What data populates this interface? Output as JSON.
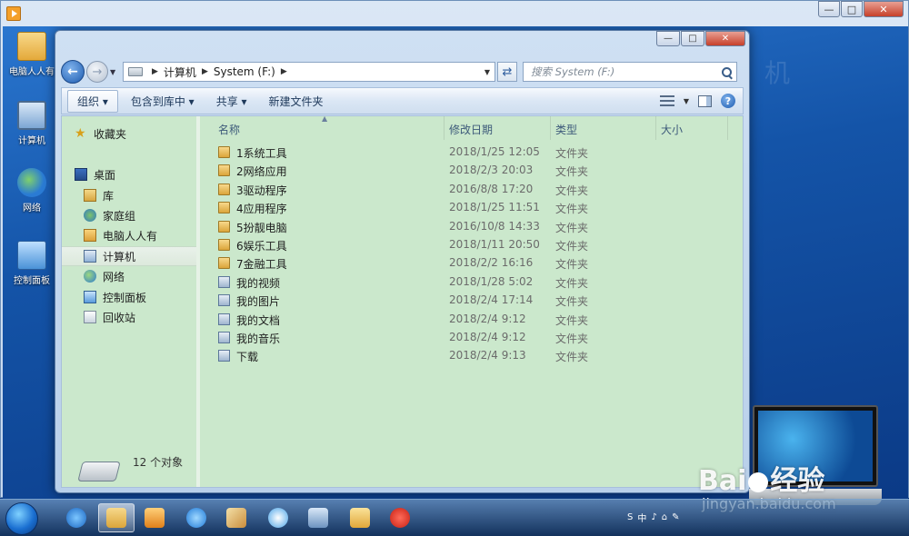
{
  "outer_window": {
    "title": "",
    "controls": {
      "minimize": "—",
      "maximize": "□",
      "close": "✕"
    }
  },
  "desktop_icons": [
    {
      "label": "电脑人人有",
      "icon": "folder-icon"
    },
    {
      "label": "计算机",
      "icon": "computer-icon"
    },
    {
      "label": "网络",
      "icon": "network-icon"
    },
    {
      "label": "控制面板",
      "icon": "control-panel-icon"
    }
  ],
  "explorer": {
    "controls": {
      "minimize": "—",
      "maximize": "□",
      "close": "✕"
    },
    "address": {
      "segments": [
        "计算机",
        "System (F:)"
      ]
    },
    "search": {
      "placeholder": "搜索 System (F:)"
    },
    "toolbar": {
      "organize": "组织 ▾",
      "include": "包含到库中 ▾",
      "share": "共享 ▾",
      "new_folder": "新建文件夹"
    },
    "nav": [
      {
        "label": "收藏夹",
        "icon": "star-icon"
      },
      {
        "label": "桌面",
        "icon": "desktop-icon"
      },
      {
        "label": "库",
        "icon": "library-icon"
      },
      {
        "label": "家庭组",
        "icon": "homegroup-icon"
      },
      {
        "label": "电脑人人有",
        "icon": "user-folder-icon"
      },
      {
        "label": "计算机",
        "icon": "computer-icon",
        "selected": true
      },
      {
        "label": "网络",
        "icon": "network-icon"
      },
      {
        "label": "控制面板",
        "icon": "control-panel-icon"
      },
      {
        "label": "回收站",
        "icon": "recycle-bin-icon"
      }
    ],
    "columns": {
      "name": "名称",
      "date": "修改日期",
      "type": "类型",
      "size": "大小"
    },
    "files": [
      {
        "name": "1系统工具",
        "date": "2018/1/25 12:05",
        "type": "文件夹",
        "icon": "folder-icon"
      },
      {
        "name": "2网络应用",
        "date": "2018/2/3 20:03",
        "type": "文件夹",
        "icon": "folder-icon"
      },
      {
        "name": "3驱动程序",
        "date": "2016/8/8 17:20",
        "type": "文件夹",
        "icon": "folder-icon"
      },
      {
        "name": "4应用程序",
        "date": "2018/1/25 11:51",
        "type": "文件夹",
        "icon": "folder-icon"
      },
      {
        "name": "5扮靓电脑",
        "date": "2016/10/8 14:33",
        "type": "文件夹",
        "icon": "folder-icon"
      },
      {
        "name": "6娱乐工具",
        "date": "2018/1/11 20:50",
        "type": "文件夹",
        "icon": "folder-icon"
      },
      {
        "name": "7金融工具",
        "date": "2018/2/2 16:16",
        "type": "文件夹",
        "icon": "folder-icon"
      },
      {
        "name": "我的视频",
        "date": "2018/1/28 5:02",
        "type": "文件夹",
        "icon": "videos-folder-icon"
      },
      {
        "name": "我的图片",
        "date": "2018/2/4 17:14",
        "type": "文件夹",
        "icon": "pictures-folder-icon"
      },
      {
        "name": "我的文档",
        "date": "2018/2/4 9:12",
        "type": "文件夹",
        "icon": "documents-folder-icon"
      },
      {
        "name": "我的音乐",
        "date": "2018/2/4 9:12",
        "type": "文件夹",
        "icon": "music-folder-icon"
      },
      {
        "name": "下载",
        "date": "2018/2/4 9:13",
        "type": "文件夹",
        "icon": "downloads-folder-icon"
      }
    ],
    "status": {
      "count": "12 个对象"
    }
  },
  "watermark": {
    "logo_left": "Bai",
    "logo_right": "经验",
    "url": "jingyan.baidu.com",
    "faint": "机"
  },
  "taskbar": {
    "apps": [
      "internet-explorer-icon",
      "explorer-icon",
      "media-player-icon",
      "chat-icon",
      "paint-icon",
      "cloud-icon",
      "remote-desktop-icon",
      "file-manager-icon",
      "chess-icon"
    ],
    "tray": [
      "S",
      "中",
      "♪",
      "⌂",
      "✎"
    ]
  },
  "colors": {
    "content_bg": "#cbe8cc",
    "accent": "#1e5cb0"
  }
}
